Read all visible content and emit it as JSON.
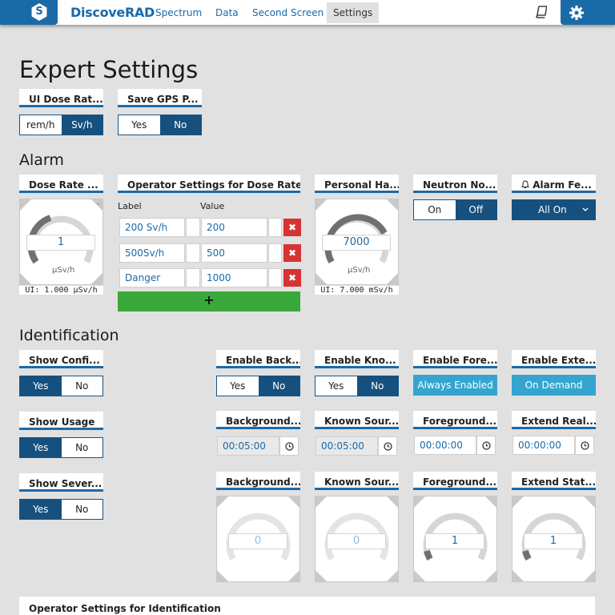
{
  "brand": "DiscoveRAD",
  "logo_letter": "S",
  "nav": [
    "Spectrum",
    "Data",
    "Second Screen",
    "Settings"
  ],
  "page_title": "Expert Settings",
  "top_cards": [
    {
      "title": "UI Dose Rat...",
      "options": [
        "rem/h",
        "Sv/h"
      ],
      "selected": 1
    },
    {
      "title": "Save GPS P...",
      "options": [
        "Yes",
        "No"
      ],
      "selected": 1
    }
  ],
  "alarm": {
    "heading": "Alarm",
    "dose_rate": {
      "title": "Dose Rate ...",
      "value": "1",
      "unit": "µSv/h",
      "ui": "UI: 1.000 µSv/h"
    },
    "operator": {
      "title": "Operator Settings for Dose Rate ...",
      "label_header": "Label",
      "value_header": "Value",
      "rows": [
        {
          "label": "200 Sv/h",
          "value": "200"
        },
        {
          "label": "500Sv/h",
          "value": "500"
        },
        {
          "label": "Danger",
          "value": "1000"
        }
      ],
      "delete_glyph": "✖",
      "add_glyph": "+"
    },
    "personal": {
      "title": "Personal Ha...",
      "value": "7000",
      "unit": "µSv/h",
      "ui": "UI: 7.000 mSv/h"
    },
    "neutron": {
      "title": "Neutron No...",
      "options": [
        "On",
        "Off"
      ],
      "selected": 1
    },
    "alarm_fe": {
      "title": "Alarm Fe...",
      "value": "All On"
    }
  },
  "identification": {
    "heading": "Identification",
    "left": [
      {
        "title": "Show Confi...",
        "options": [
          "Yes",
          "No"
        ],
        "selected": 0
      },
      {
        "title": "Show Usage",
        "options": [
          "Yes",
          "No"
        ],
        "selected": 0
      },
      {
        "title": "Show Sever...",
        "options": [
          "Yes",
          "No"
        ],
        "selected": 0
      }
    ],
    "row1": [
      {
        "title": "Enable Back...",
        "options": [
          "Yes",
          "No"
        ],
        "selected": 1
      },
      {
        "title": "Enable Kno...",
        "options": [
          "Yes",
          "No"
        ],
        "selected": 1
      },
      {
        "title": "Enable Fore...",
        "banner": "Always Enabled"
      },
      {
        "title": "Enable Exte...",
        "banner": "On Demand"
      }
    ],
    "row2": [
      {
        "title": "Background...",
        "time": "00:05:00"
      },
      {
        "title": "Known Sour...",
        "time": "00:05:00"
      },
      {
        "title": "Foreground...",
        "time": "00:00:00"
      },
      {
        "title": "Extend Real...",
        "time": "00:00:00"
      }
    ],
    "row3": [
      {
        "title": "Background...",
        "value": "0"
      },
      {
        "title": "Known Sour...",
        "value": "0"
      },
      {
        "title": "Foreground...",
        "value": "1"
      },
      {
        "title": "Extend Stat...",
        "value": "1"
      }
    ]
  },
  "bottom_title": "Operator Settings for Identification",
  "colors": {
    "primary": "#1a6aa8",
    "dark": "#15507e",
    "danger": "#d63333",
    "add": "#3aa83a",
    "banner": "#35a5d0"
  }
}
